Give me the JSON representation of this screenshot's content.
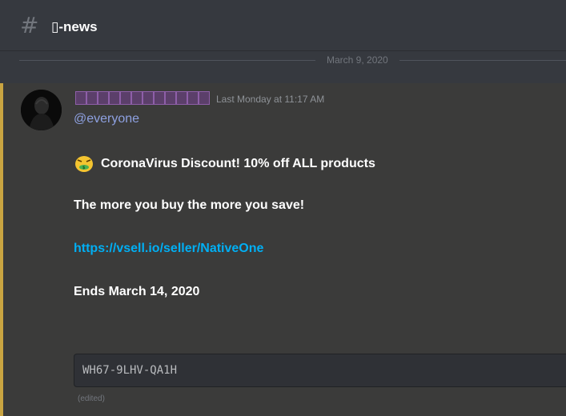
{
  "channel": {
    "hash_icon": "hash-icon",
    "name": "▯-news"
  },
  "divider": {
    "date": "March 9, 2020"
  },
  "message": {
    "timestamp": "Last Monday at 11:17 AM",
    "mention": "@everyone",
    "emoji_icon": "money-mouth-face-icon",
    "line1": "CoronaVirus Discount!  10% off ALL products",
    "line2": "The more you buy the more you save!",
    "link": "https://vsell.io/seller/NativeOne",
    "line3": "Ends March 14, 2020",
    "code": "WH67-9LHV-QA1H",
    "edited": "(edited)"
  },
  "colors": {
    "background": "#36393f",
    "highlight": "#3b3b3a",
    "accent_bar": "#c9a441",
    "mention": "#8ea1e1",
    "link": "#00aff4"
  }
}
